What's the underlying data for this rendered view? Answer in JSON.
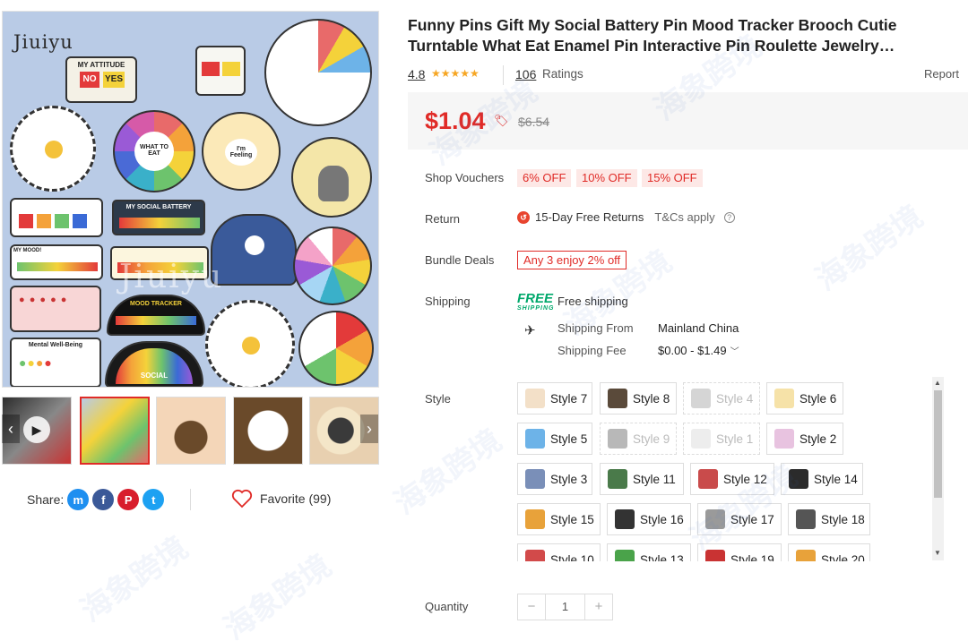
{
  "product": {
    "title": "Funny Pins Gift My Social Battery Pin Mood Tracker Brooch Cutie Turntable What Eat Enamel Pin Interactive Pin Roulette Jewelry…",
    "rating": "4.8",
    "stars": "★★★★★",
    "rating_count": "106",
    "ratings_label": "Ratings",
    "report_label": "Report"
  },
  "gallery": {
    "brand_text": "Jiuiyu",
    "pin_labels": {
      "attitude": "MY ATTITUDE",
      "no": "NO",
      "yes": "YES",
      "what_to_eat": "WHAT TO EAT",
      "feeling": "I'm Feeling",
      "social_battery": "MY SOCIAL BATTERY",
      "my_mood": "MY MOOD!",
      "mood_tracker": "MOOD TRACKER",
      "well_being": "Mental Well-Being",
      "social": "SOCIAL"
    }
  },
  "price": {
    "current": "$1.04",
    "original": "$6.54",
    "accent_color": "#e02b27"
  },
  "vouchers": {
    "label": "Shop Vouchers",
    "items": [
      "6% OFF",
      "10% OFF",
      "15% OFF"
    ]
  },
  "return": {
    "label": "Return",
    "text": "15-Day Free Returns",
    "tc": "T&Cs apply"
  },
  "bundle": {
    "label": "Bundle Deals",
    "text": "Any 3 enjoy 2% off"
  },
  "shipping": {
    "label": "Shipping",
    "free_badge": "FREE",
    "free_badge_sub": "SHIPPING",
    "free_text": "Free shipping",
    "from_label": "Shipping From",
    "from_value": "Mainland China",
    "fee_label": "Shipping Fee",
    "fee_value": "$0.00 - $1.49"
  },
  "style": {
    "label": "Style",
    "options": [
      {
        "label": "Style 7",
        "disabled": false,
        "color": "#f3e0c8"
      },
      {
        "label": "Style 8",
        "disabled": false,
        "color": "#5a4a3a"
      },
      {
        "label": "Style 4",
        "disabled": true,
        "color": "#888888"
      },
      {
        "label": "Style 6",
        "disabled": false,
        "color": "#f6e2a8"
      },
      {
        "label": "Style 5",
        "disabled": false,
        "color": "#6db3e8"
      },
      {
        "label": "Style 9",
        "disabled": true,
        "color": "#333333"
      },
      {
        "label": "Style 1",
        "disabled": true,
        "color": "#cccccc"
      },
      {
        "label": "Style 2",
        "disabled": false,
        "color": "#e8c3e0"
      },
      {
        "label": "Style 3",
        "disabled": false,
        "color": "#7a8fb8"
      },
      {
        "label": "Style 11",
        "disabled": false,
        "color": "#4a7a4a"
      },
      {
        "label": "Style 12",
        "disabled": false,
        "color": "#c94b4b"
      },
      {
        "label": "Style 14",
        "disabled": false,
        "color": "#2b2b2b"
      },
      {
        "label": "Style 15",
        "disabled": false,
        "color": "#e8a23a"
      },
      {
        "label": "Style 16",
        "disabled": false,
        "color": "#333333"
      },
      {
        "label": "Style 17",
        "disabled": false,
        "color": "#9a9a9a"
      },
      {
        "label": "Style 18",
        "disabled": false,
        "color": "#555555"
      },
      {
        "label": "Style 10",
        "disabled": false,
        "color": "#d24a4a"
      },
      {
        "label": "Style 13",
        "disabled": false,
        "color": "#4aa34a"
      },
      {
        "label": "Style 19",
        "disabled": false,
        "color": "#c93333"
      },
      {
        "label": "Style 20",
        "disabled": false,
        "color": "#e8a23a"
      }
    ]
  },
  "quantity": {
    "label": "Quantity",
    "value": "1",
    "minus": "−",
    "plus": "+"
  },
  "share": {
    "label": "Share:",
    "messenger": "m",
    "facebook": "f",
    "pinterest": "P",
    "twitter": "t"
  },
  "favorite": {
    "text": "Favorite (99)"
  }
}
